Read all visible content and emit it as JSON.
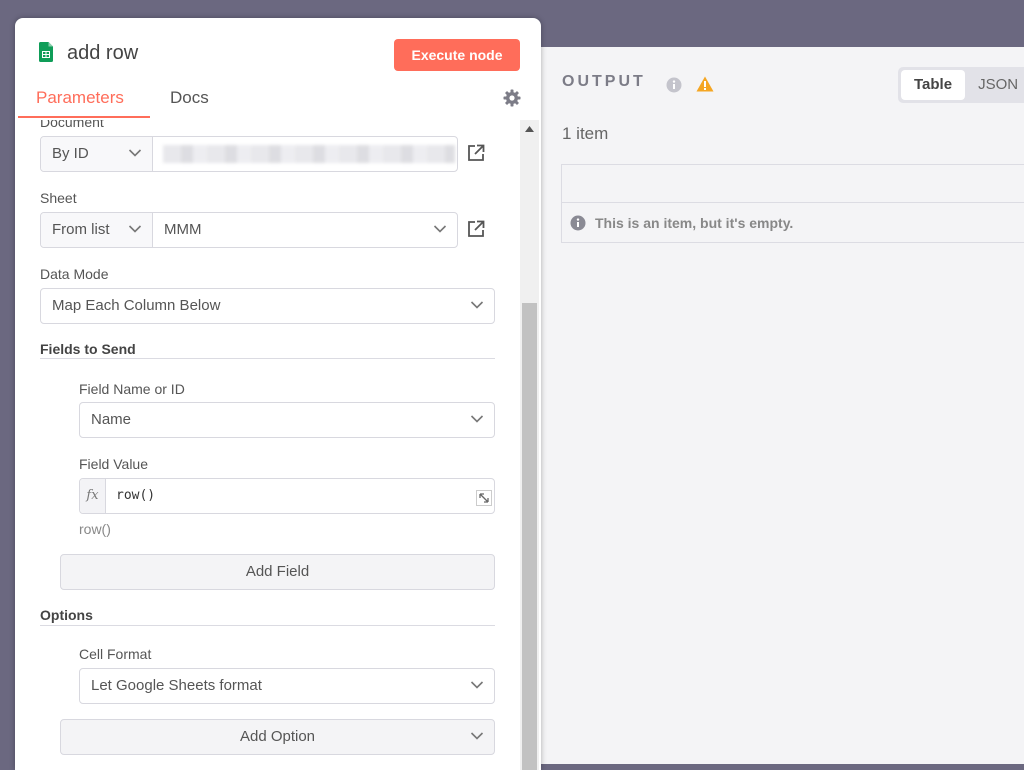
{
  "node": {
    "title": "add row",
    "execute_label": "Execute node",
    "accent_color": "#ff6d5a",
    "icon": "google-sheets-icon"
  },
  "tabs": [
    {
      "label": "Parameters",
      "active": true
    },
    {
      "label": "Docs",
      "active": false
    }
  ],
  "params": {
    "document": {
      "label": "Document",
      "mode": "By ID",
      "value": ""
    },
    "sheet": {
      "label": "Sheet",
      "mode": "From list",
      "value": "MMM"
    },
    "data_mode": {
      "label": "Data Mode",
      "value": "Map Each Column Below"
    },
    "fields_to_send": {
      "title": "Fields to Send",
      "field_name_label": "Field Name or ID",
      "field_name_value": "Name",
      "field_value_label": "Field Value",
      "fx_symbol": "fx",
      "field_value": "row()",
      "field_value_preview": "row()",
      "add_field_label": "Add Field"
    },
    "options": {
      "title": "Options",
      "cell_format_label": "Cell Format",
      "cell_format_value": "Let Google Sheets format",
      "add_option_label": "Add Option"
    }
  },
  "output": {
    "title": "OUTPUT",
    "views": [
      {
        "label": "Table",
        "active": true
      },
      {
        "label": "JSON",
        "active": false
      }
    ],
    "item_count": "1 item",
    "empty_message": "This is an item, but it's empty."
  }
}
